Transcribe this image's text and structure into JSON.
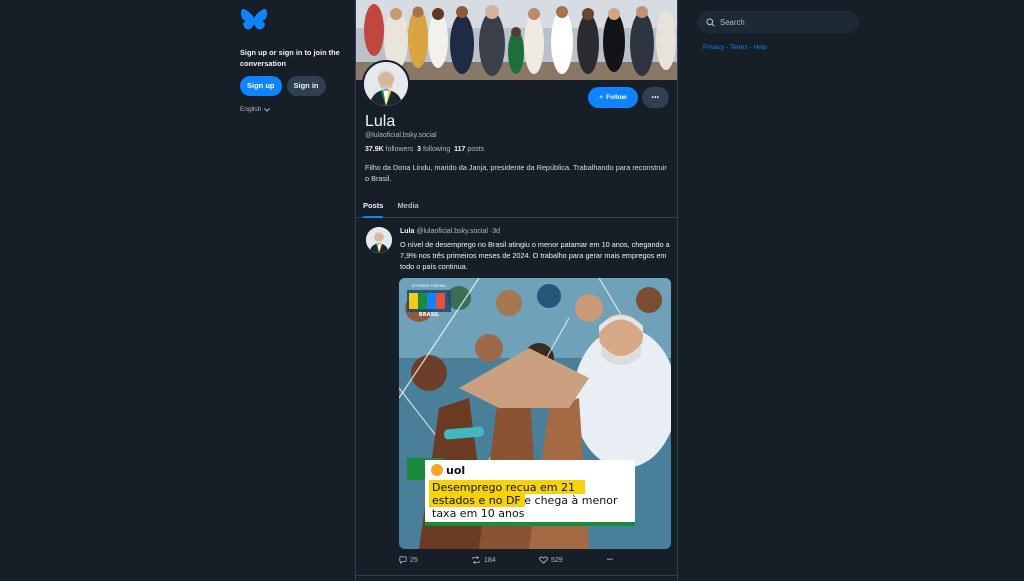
{
  "sidebar": {
    "logo_icon": "butterfly-icon",
    "tagline": "Sign up or sign in to join the conversation",
    "signup_label": "Sign up",
    "signin_label": "Sign in",
    "language": "English"
  },
  "profile": {
    "name": "Lula",
    "handle": "@lulaoficial.bsky.social",
    "followers_count": "37.9K",
    "followers_label": "followers",
    "following_count": "3",
    "following_label": "following",
    "posts_count": "117",
    "posts_label": "posts",
    "bio": "Filho da Dona Lindu, marido da Janja, presidente da República. Trabalhando para reconstruir o Brasil.",
    "follow_label": "Follow",
    "more_label": "•••"
  },
  "tabs": [
    {
      "label": "Posts",
      "active": true
    },
    {
      "label": "Media",
      "active": false
    }
  ],
  "post": {
    "author": "Lula",
    "handle": "@lulaoficial.bsky.social",
    "separator": "·",
    "time": "3d",
    "text": "O nível de desemprego no Brasil atingiu o menor patamar em 10 anos, chegando a 7,9% nos três primeiros meses de 2024. O trabalho para gerar mais empregos em todo o país continua.",
    "image": {
      "brand": "uol",
      "badge_top": "GOVERNO FEDERAL",
      "badge_word": "BRASIL",
      "headline_highlight_1": "Desemprego recua em 21",
      "headline_highlight_2": "estados e no DF",
      "headline_rest_1": " e chega à menor",
      "headline_rest_2": "taxa em 10 anos"
    },
    "replies": "25",
    "reposts": "184",
    "likes": "529"
  },
  "search": {
    "placeholder": "Search"
  },
  "footer_links": {
    "privacy": "Privacy",
    "sep": " · ",
    "terms": "Terms",
    "help": "Help"
  },
  "colors": {
    "background": "#161e27",
    "accent": "#1083fe",
    "border": "#2e4052",
    "highlight": "#f5d20a"
  }
}
